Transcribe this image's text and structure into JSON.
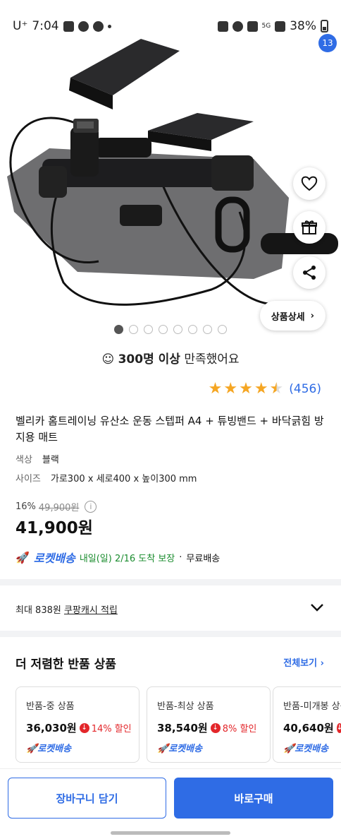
{
  "status_bar": {
    "carrier": "U⁺",
    "time": "7:04",
    "battery": "38%",
    "network": "5G"
  },
  "nav": {
    "back_icon": "chevron-left-icon",
    "search_icon": "search-icon",
    "home_icon": "home-icon",
    "cart_icon": "cart-icon",
    "cart_count": "13"
  },
  "gallery": {
    "total_dots": 8,
    "active_index": 0,
    "detail_label": "상품상세"
  },
  "satisfaction": {
    "bold": "300명 이상",
    "rest": "만족했어요"
  },
  "rating": {
    "stars": 4.5,
    "count": "(456)"
  },
  "product": {
    "title": "벨리카 홈트레이닝 유산소 운동 스텝퍼 A4 + 튜빙밴드 + 바닥긁힘 방지용 매트",
    "options": [
      {
        "label": "색상",
        "value": "블랙"
      },
      {
        "label": "사이즈",
        "value": "가로300 x 세로400 x 높이300 mm"
      }
    ],
    "discount_rate": "16%",
    "original_price": "49,900원",
    "price": "41,900원"
  },
  "delivery": {
    "rocket": "로켓배송",
    "eta": "내일(일) 2/16 도착 보장",
    "sep": "·",
    "free": "무료배송"
  },
  "cash": {
    "prefix": "최대 838원 ",
    "link": "쿠팡캐시 적립"
  },
  "returns": {
    "heading": "더 저렴한 반품 상품",
    "view_all": "전체보기",
    "cards": [
      {
        "label": "반품-중 상품",
        "price": "36,030원",
        "discount": "14% 할인",
        "rocket": "로켓배송"
      },
      {
        "label": "반품-최상 상품",
        "price": "38,540원",
        "discount": "8% 할인",
        "rocket": "로켓배송"
      },
      {
        "label": "반품-미개봉 상품",
        "price": "40,640원",
        "discount": "",
        "rocket": "로켓배송"
      }
    ]
  },
  "actions": {
    "cart": "장바구니 담기",
    "buy": "바로구매"
  },
  "colors": {
    "accent": "#2f6ce5",
    "discount_red": "#e3262a",
    "star": "#f5a623",
    "delivery_green": "#1a8c2e"
  }
}
